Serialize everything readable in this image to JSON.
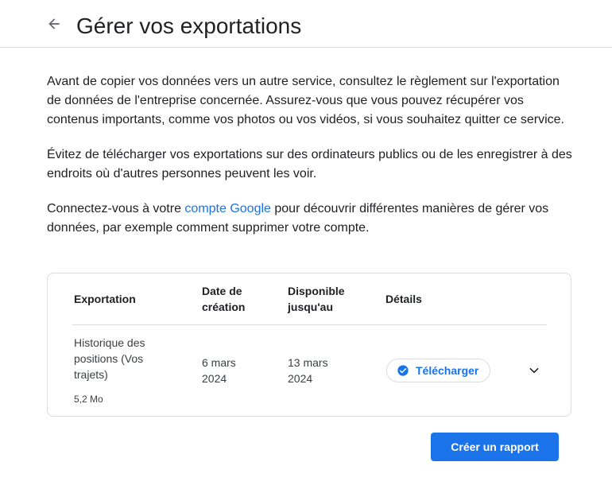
{
  "header": {
    "title": "Gérer vos exportations",
    "back_icon": "arrow-back-icon"
  },
  "intro": {
    "p1": "Avant de copier vos données vers un autre service, consultez le règlement sur l'exportation de données de l'entreprise concernée. Assurez-vous que vous pouvez récupérer vos contenus importants, comme vos photos ou vos vidéos, si vous souhaitez quitter ce service.",
    "p2": "Évitez de télécharger vos exportations sur des ordinateurs publics ou de les enregistrer à des endroits où d'autres personnes peuvent les voir.",
    "p3_before": "Connectez-vous à votre ",
    "p3_link": "compte Google",
    "p3_after": " pour découvrir différentes manières de gérer vos données, par exemple comment supprimer votre compte."
  },
  "table": {
    "headers": {
      "export": "Exportation",
      "created": "Date de création",
      "available": "Disponible jusqu'au",
      "details": "Détails"
    },
    "rows": [
      {
        "name": "Historique des positions (Vos trajets)",
        "size": "5,2 Mo",
        "created": "6 mars 2024",
        "available": "13 mars 2024",
        "download_label": "Télécharger",
        "download_icon": "check-circle-icon",
        "expand_icon": "chevron-down-icon"
      }
    ]
  },
  "actions": {
    "create_report": "Créer un rapport"
  },
  "colors": {
    "accent": "#1a73e8",
    "text": "#202124",
    "border": "#dadce0"
  }
}
